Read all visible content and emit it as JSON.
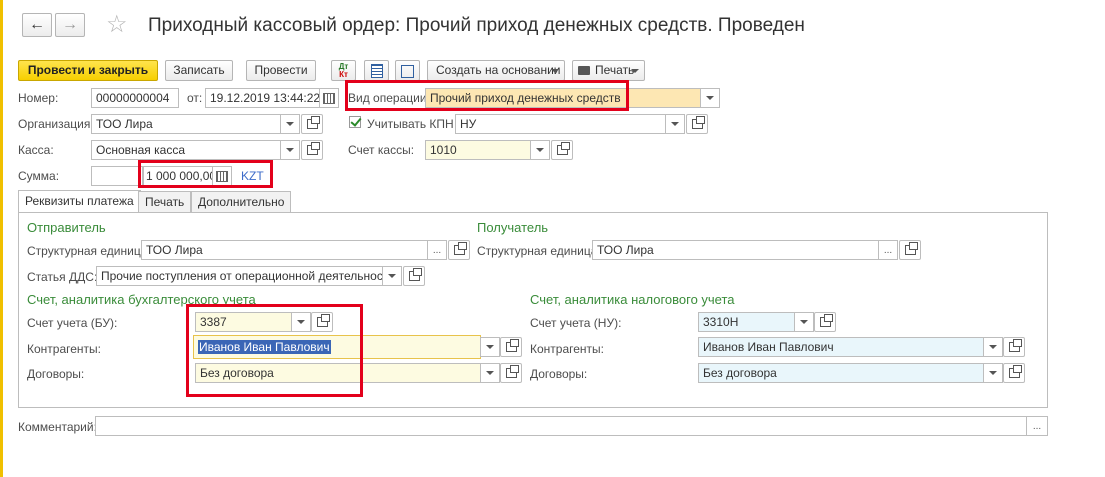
{
  "header": {
    "back_arrow": "←",
    "forward_arrow": "→",
    "star": "☆",
    "title": "Приходный кассовый ордер: Прочий приход денежных средств. Проведен"
  },
  "toolbar": {
    "post_close": "Провести и закрыть",
    "write": "Записать",
    "post": "Провести",
    "dtkt_top": "Дт",
    "dtkt_bottom": "Кт",
    "create_based": "Создать на основании",
    "print": "Печать"
  },
  "form": {
    "number_label": "Номер:",
    "number_value": "00000000004",
    "date_label": "от:",
    "date_value": "19.12.2019 13:44:22",
    "operation_label": "Вид операции:",
    "operation_value": "Прочий приход денежных средств",
    "org_label": "Организация:",
    "org_value": "ТОО Лира",
    "kpn_label": "Учитывать КПН",
    "kpn_value": "НУ",
    "cash_label": "Касса:",
    "cash_value": "Основная касса",
    "cash_account_label": "Счет кассы:",
    "cash_account_value": "1010",
    "sum_label": "Сумма:",
    "sum_value": "1 000 000,00",
    "currency": "KZT"
  },
  "tabs": [
    "Реквизиты платежа",
    "Печать",
    "Дополнительно"
  ],
  "sender": {
    "title": "Отправитель",
    "unit_label": "Структурная единица:",
    "unit_value": "ТОО Лира",
    "dds_label": "Статья ДДС:",
    "dds_value": "Прочие поступления от операционной деятельности"
  },
  "receiver": {
    "title": "Получатель",
    "unit_label": "Структурная единица:",
    "unit_value": "ТОО Лира"
  },
  "bu": {
    "title": "Счет, аналитика бухгалтерского учета",
    "account_label": "Счет учета (БУ):",
    "account_value": "3387",
    "contractors_label": "Контрагенты:",
    "contractors_value": "Иванов Иван Павлович",
    "contracts_label": "Договоры:",
    "contracts_value": "Без договора"
  },
  "nu": {
    "title": "Счет, аналитика налогового учета",
    "account_label": "Счет учета (НУ):",
    "account_value": "3310Н",
    "contractors_label": "Контрагенты:",
    "contractors_value": "Иванов Иван Павлович",
    "contracts_label": "Договоры:",
    "contracts_value": "Без договора"
  },
  "comment": {
    "label": "Комментарий:",
    "value": ""
  },
  "dots": "...",
  "colors": {
    "accent_red": "#e3001b",
    "section_green": "#3a8c3a",
    "primary_yellow": "#f7cf00"
  }
}
